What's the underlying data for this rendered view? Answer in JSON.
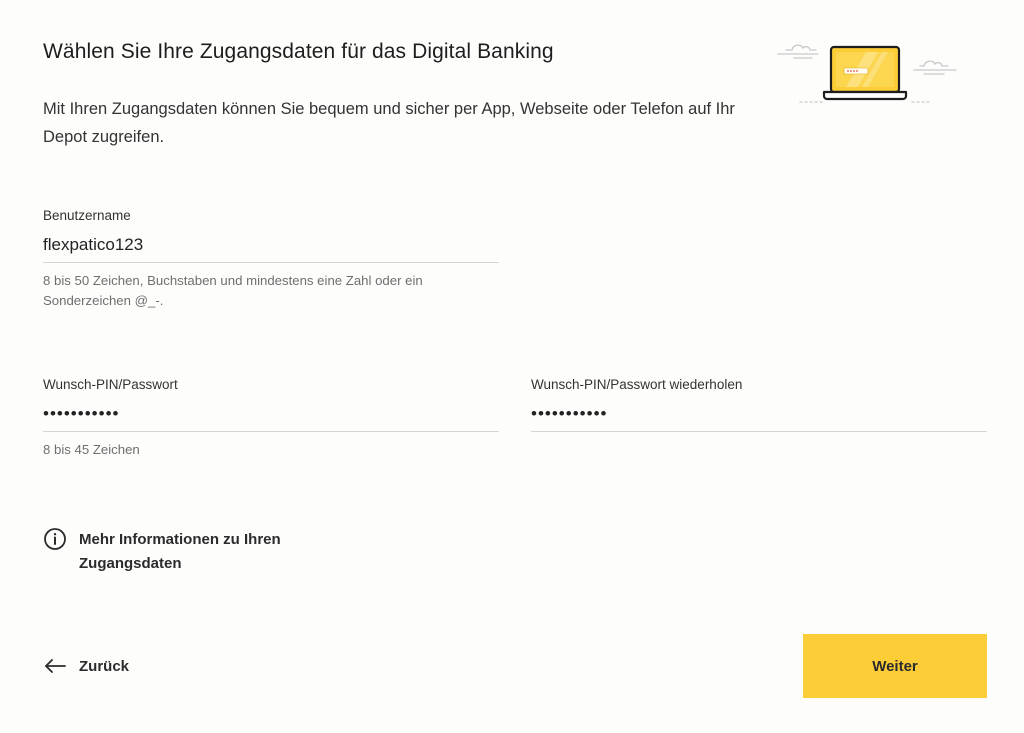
{
  "header": {
    "title": "Wählen Sie Ihre Zugangsdaten für das Digital Banking",
    "intro": "Mit Ihren Zugangsdaten können Sie bequem und sicher per App, Webseite oder Telefon auf Ihr Depot zugreifen."
  },
  "illustration": {
    "icon": "laptop-illustration",
    "accent_color": "#fccd37"
  },
  "form": {
    "username": {
      "label": "Benutzername",
      "value": "flexpatico123",
      "hint": "8 bis 50 Zeichen, Buchstaben und mindestens eine Zahl oder ein Sonderzeichen @_-."
    },
    "password": {
      "label": "Wunsch-PIN/Passwort",
      "value": "•••••••••••",
      "hint": "8 bis 45 Zeichen"
    },
    "password_repeat": {
      "label": "Wunsch-PIN/Passwort wiederholen",
      "value": "•••••••••••"
    }
  },
  "info": {
    "icon": "info-icon",
    "label": "Mehr Informationen zu Ihren Zugangsdaten"
  },
  "navigation": {
    "back_icon": "arrow-left-icon",
    "back_label": "Zurück",
    "next_label": "Weiter",
    "next_color": "#fccd37"
  }
}
